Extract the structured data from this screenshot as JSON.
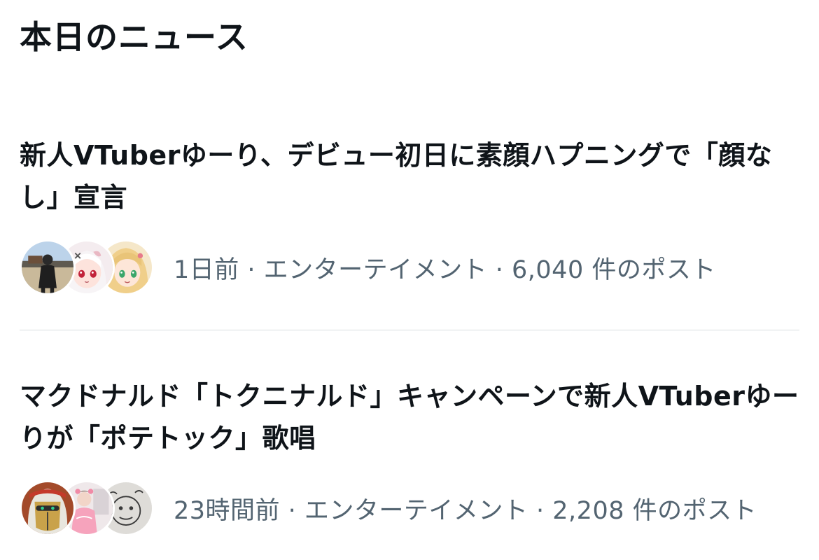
{
  "section": {
    "title": "本日のニュース"
  },
  "news": [
    {
      "headline": "新人VTuberゆーり、デビュー初日に素顔ハプニングで「顔なし」宣言",
      "meta": "1日前 · エンターテイメント · 6,040 件のポスト",
      "avatars": [
        "person-photo-avatar",
        "anime-girl-white-hair-avatar",
        "anime-girl-blonde-avatar"
      ]
    },
    {
      "headline": "マクドナルド「トクニナルド」キャンペーンで新人VTuberゆーりが「ポテトック」歌唱",
      "meta": "23時間前 · エンターテイメント · 2,208 件のポスト",
      "avatars": [
        "masked-character-avatar",
        "pink-outfit-photo-avatar",
        "sketch-face-avatar"
      ]
    }
  ]
}
